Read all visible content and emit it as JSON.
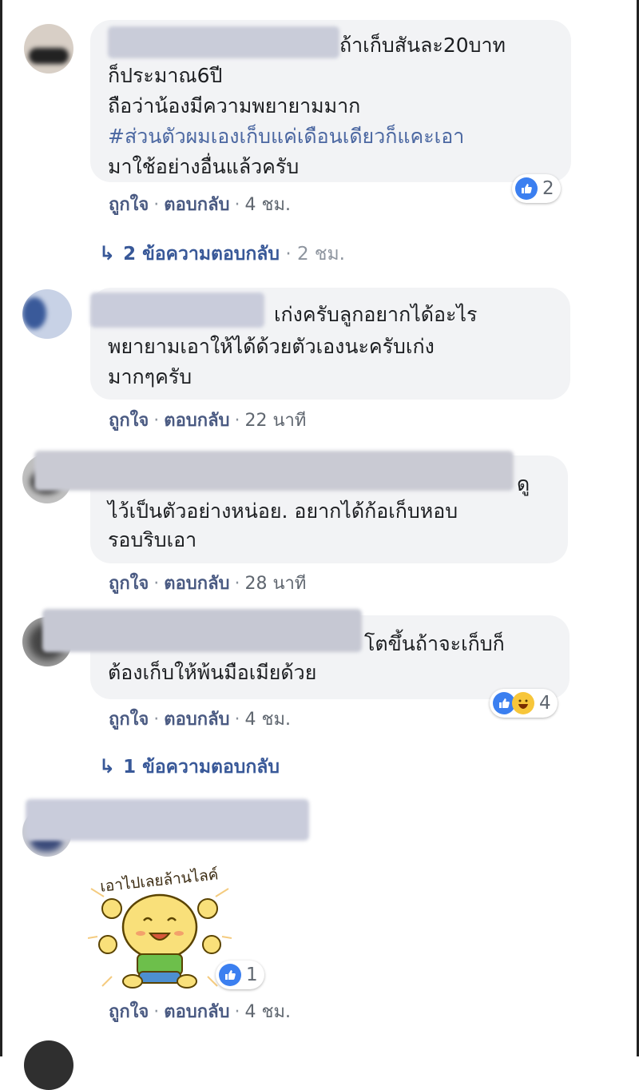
{
  "comments": [
    {
      "lines": [
        "ถ้าเก็บสันละ20บาท",
        "ก็ประมาณ6ปี",
        "ถือว่าน้องมีความพยายามมาก",
        "#ส่วนตัวผมเองเก็บแค่เดือนเดียวก็แคะเอา",
        "มาใช้อย่างอื่นแล้วครับ"
      ],
      "like_label": "ถูกใจ",
      "reply_label": "ตอบกลับ",
      "time": "4 ชม.",
      "reaction_count": "2",
      "replies": {
        "label": "2 ข้อความตอบกลับ",
        "time": "2 ชม."
      }
    },
    {
      "lines": [
        "เก่งครับลูกอยากได้อะไร",
        "พยายามเอาให้ได้ด้วยตัวเองนะครับเก่ง",
        "มากๆครับ"
      ],
      "like_label": "ถูกใจ",
      "reply_label": "ตอบกลับ",
      "time": "22 นาที"
    },
    {
      "lines": [
        "ดู",
        "ไว้เป็นตัวอย่างหน่อย. อยากได้ก้อเก็บหอบ",
        "รอบริบเอา"
      ],
      "like_label": "ถูกใจ",
      "reply_label": "ตอบกลับ",
      "time": "28 นาที"
    },
    {
      "lines": [
        "โตขึ้นถ้าจะเก็บก็",
        "ต้องเก็บให้พ้นมือเมียด้วย"
      ],
      "like_label": "ถูกใจ",
      "reply_label": "ตอบกลับ",
      "time": "4 ชม.",
      "reaction_count": "4",
      "replies": {
        "label": "1 ข้อความตอบกลับ"
      }
    },
    {
      "sticker_text": "เอาไปเลยล้านไลค์",
      "like_label": "ถูกใจ",
      "reply_label": "ตอบกลับ",
      "time": "4 ชม.",
      "reaction_count": "1"
    }
  ],
  "colors": {
    "bubble": "#f2f3f5",
    "link": "#385898",
    "like_blue": "#3b7ff0",
    "haha_yellow": "#f7c63a"
  },
  "icons": {
    "reply_arrow": "reply-arrow-icon",
    "like": "like-reaction-icon",
    "haha": "haha-reaction-icon"
  }
}
